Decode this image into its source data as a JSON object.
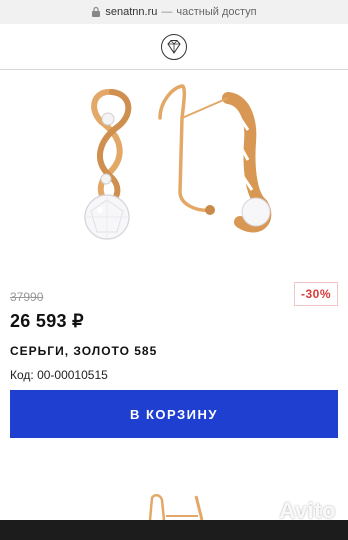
{
  "browser": {
    "domain": "senatnn.ru",
    "separator": "—",
    "site_caption": "частный доступ"
  },
  "header": {
    "logo_icon": "diamond-icon"
  },
  "product": {
    "old_price": "37990",
    "discount": "-30%",
    "discount_fraction": 0.3,
    "price": "26 593 ₽",
    "title": "СЕРЬГИ, ЗОЛОТО 585",
    "sku": "Код: 00-00010515",
    "cart_button_label": "В КОРЗИНУ"
  },
  "watermark": {
    "text": "Avito"
  },
  "colors": {
    "accent": "#1f3fd1",
    "discount": "#d83a3a",
    "gold": "#e3a867"
  }
}
